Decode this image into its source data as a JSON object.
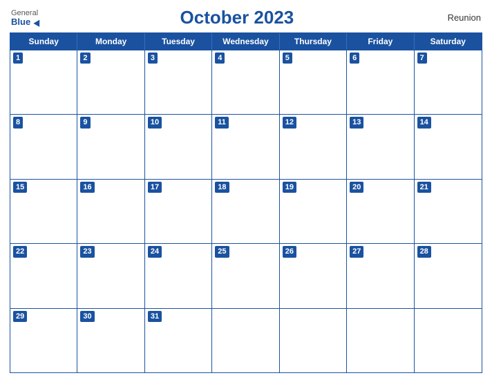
{
  "header": {
    "logo": {
      "general": "General",
      "blue": "Blue"
    },
    "title": "October 2023",
    "region": "Reunion"
  },
  "days_of_week": [
    "Sunday",
    "Monday",
    "Tuesday",
    "Wednesday",
    "Thursday",
    "Friday",
    "Saturday"
  ],
  "weeks": [
    [
      {
        "date": "1",
        "has_date": true
      },
      {
        "date": "2",
        "has_date": true
      },
      {
        "date": "3",
        "has_date": true
      },
      {
        "date": "4",
        "has_date": true
      },
      {
        "date": "5",
        "has_date": true
      },
      {
        "date": "6",
        "has_date": true
      },
      {
        "date": "7",
        "has_date": true
      }
    ],
    [
      {
        "date": "8",
        "has_date": true
      },
      {
        "date": "9",
        "has_date": true
      },
      {
        "date": "10",
        "has_date": true
      },
      {
        "date": "11",
        "has_date": true
      },
      {
        "date": "12",
        "has_date": true
      },
      {
        "date": "13",
        "has_date": true
      },
      {
        "date": "14",
        "has_date": true
      }
    ],
    [
      {
        "date": "15",
        "has_date": true
      },
      {
        "date": "16",
        "has_date": true
      },
      {
        "date": "17",
        "has_date": true
      },
      {
        "date": "18",
        "has_date": true
      },
      {
        "date": "19",
        "has_date": true
      },
      {
        "date": "20",
        "has_date": true
      },
      {
        "date": "21",
        "has_date": true
      }
    ],
    [
      {
        "date": "22",
        "has_date": true
      },
      {
        "date": "23",
        "has_date": true
      },
      {
        "date": "24",
        "has_date": true
      },
      {
        "date": "25",
        "has_date": true
      },
      {
        "date": "26",
        "has_date": true
      },
      {
        "date": "27",
        "has_date": true
      },
      {
        "date": "28",
        "has_date": true
      }
    ],
    [
      {
        "date": "29",
        "has_date": true
      },
      {
        "date": "30",
        "has_date": true
      },
      {
        "date": "31",
        "has_date": true
      },
      {
        "date": "",
        "has_date": false
      },
      {
        "date": "",
        "has_date": false
      },
      {
        "date": "",
        "has_date": false
      },
      {
        "date": "",
        "has_date": false
      }
    ]
  ]
}
